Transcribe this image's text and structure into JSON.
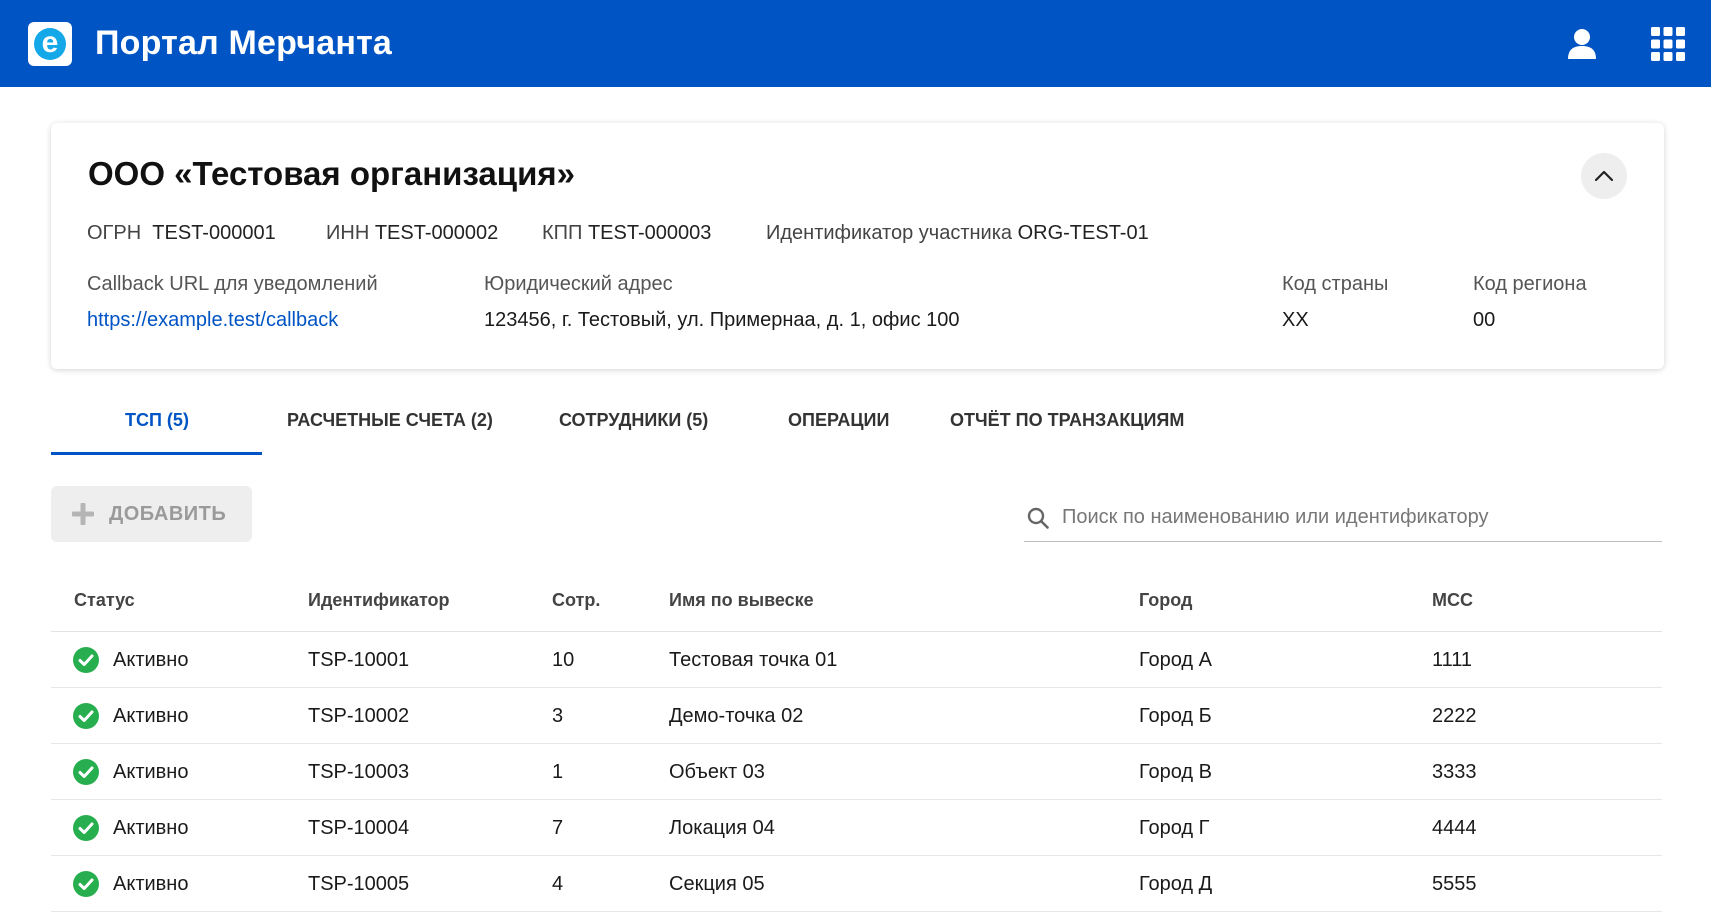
{
  "header": {
    "logo_letter": "e",
    "title": "Портал Мерчанта",
    "user_icon": "user-icon",
    "apps_icon": "apps-grid-icon"
  },
  "organization": {
    "name": "ООО «Тестовая организация»",
    "ogrn_label": "ОГРН",
    "ogrn": "TEST-000001",
    "inn_label": "ИНН",
    "inn": "TEST-000002",
    "kpp_label": "КПП",
    "kpp": "TEST-000003",
    "participant_label": "Идентификатор участника",
    "participant_id": "ORG-TEST-01",
    "callback_label": "Callback URL для уведомлений",
    "callback_url": "https://example.test/callback",
    "address_label": "Юридический адрес",
    "address": "123456, г. Тестовый, ул. Примернаа, д. 1, офис 100",
    "country_label": "Код страны",
    "country_code": "XX",
    "region_label": "Код региона",
    "region_code": "00"
  },
  "tabs": [
    {
      "label": "ТСП (5)",
      "active": true
    },
    {
      "label": "РАСЧЕТНЫЕ СЧЕТА (2)",
      "active": false
    },
    {
      "label": "СОТРУДНИКИ (5)",
      "active": false
    },
    {
      "label": "ОПЕРАЦИИ",
      "active": false
    },
    {
      "label": "ОТЧЁТ ПО ТРАНЗАКЦИЯМ",
      "active": false
    }
  ],
  "toolbar": {
    "add_label": "ДОБАВИТЬ",
    "search_placeholder": "Поиск по наименованию или идентификатору",
    "search_value": ""
  },
  "table": {
    "columns": [
      "Статус",
      "Идентификатор",
      "Сотр.",
      "Имя по вывеске",
      "Город",
      "MCC"
    ],
    "rows": [
      {
        "status": "Активно",
        "id": "TSP-10001",
        "staff": "10",
        "name": "Тестовая точка 01",
        "city": "Город А",
        "mcc": "1111"
      },
      {
        "status": "Активно",
        "id": "TSP-10002",
        "staff": "3",
        "name": "Демо-точка 02",
        "city": "Город Б",
        "mcc": "2222"
      },
      {
        "status": "Активно",
        "id": "TSP-10003",
        "staff": "1",
        "name": "Объект 03",
        "city": "Город В",
        "mcc": "3333"
      },
      {
        "status": "Активно",
        "id": "TSP-10004",
        "staff": "7",
        "name": "Локация 04",
        "city": "Город Г",
        "mcc": "4444"
      },
      {
        "status": "Активно",
        "id": "TSP-10005",
        "staff": "4",
        "name": "Секция 05",
        "city": "Город Д",
        "mcc": "5555"
      }
    ]
  },
  "colors": {
    "primary": "#0054c4",
    "status_active": "#27ae4f"
  }
}
